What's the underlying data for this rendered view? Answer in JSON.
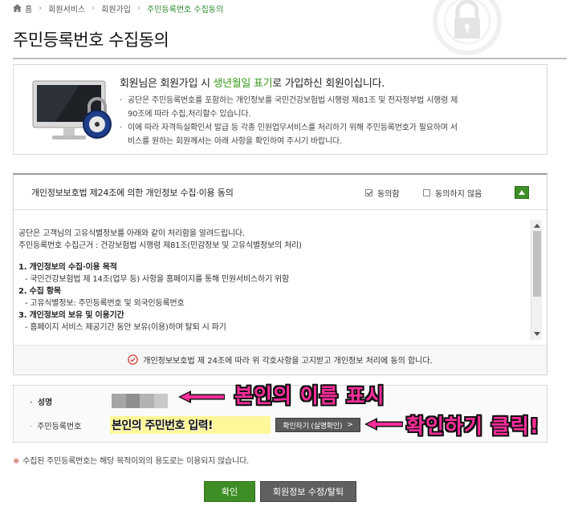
{
  "breadcrumb": {
    "home": "홈",
    "items": [
      "회원서비스",
      "회원가입"
    ],
    "current": "주민등록번호 수집동의"
  },
  "page_title": "주민등록번호 수집동의",
  "info": {
    "headline_pre": "회원님은 회원가입 시 ",
    "headline_highlight": "생년월일 표기",
    "headline_post": "로 가입하신 회원이십니다.",
    "bullet1_line1": "공단은 주민등록번호를 포함하는 개인정보를 국민건강보험법 시행령 제81조 및 전자정부법 시행령 제",
    "bullet1_line2": "90조에 따라 수집,처리할수 있습니다.",
    "bullet2_line1": "이에 따라 자격득실확인서 발급 등 각종 민원업무서비스를 처리하기 위해 주민등록번호가 필요하며 서",
    "bullet2_line2": "비스를 원하는 회원께서는 아래 사항을 확인하여 주시기 바랍니다."
  },
  "consent": {
    "title": "개인정보보호법 제24조에 의한 개인정보 수집·이용 동의",
    "agree_label": "동의함",
    "disagree_label": "동의하지 않음",
    "agree_checked": true,
    "terms": {
      "intro1": "공단은 고객님의 고유식별정보를 아래와 같이 처리함을 알려드립니다.",
      "intro2": "주민등록번호 수집근거 : 건강보험법 시행령 제81조(민감정보 및 고유식별정보의 처리)",
      "sec1": "1. 개인정보의 수집·이용 목적",
      "sec1_item": "- 국민건강보험법 제 14조(업무 등) 사항을 홈페이지를 통해 민원서비스하기 위함",
      "sec2": "2. 수집 항목",
      "sec2_item": "- 고유식별정보: 주민등록번호 및 외국인등록번호",
      "sec3": "3. 개인정보의 보유 및 이용기간",
      "sec3_item": "- 홈페이지 서비스 제공기간 동안 보유(이용)하며 탈퇴 시 파기"
    },
    "notice": "개인정보보호법 제 24조에 따라 위 각호사항을 고지받고 개인정보 처리에 동의 합니다."
  },
  "form": {
    "name_label": "성명",
    "rrn_label": "주민등록번호",
    "rrn_value": "본인의 주민번호 입력!",
    "verify_label": "확인하기 (실명확인)",
    "verify_arrow": ">"
  },
  "annotations": {
    "name": "본인의 이름 표시",
    "click": "확인하기 클릭!"
  },
  "footnote": {
    "mark": "※",
    "text": "수집된 주민등록번호는 해당 목적이외의 용도로는 이용되지 않습니다."
  },
  "buttons": {
    "confirm": "확인",
    "edit": "회원정보 수정/탈퇴"
  },
  "colors": {
    "accent_green": "#3e8e25",
    "annotation_pink": "#ff2d9b",
    "rrn_highlight": "#fff799",
    "button_gray": "#606060"
  }
}
